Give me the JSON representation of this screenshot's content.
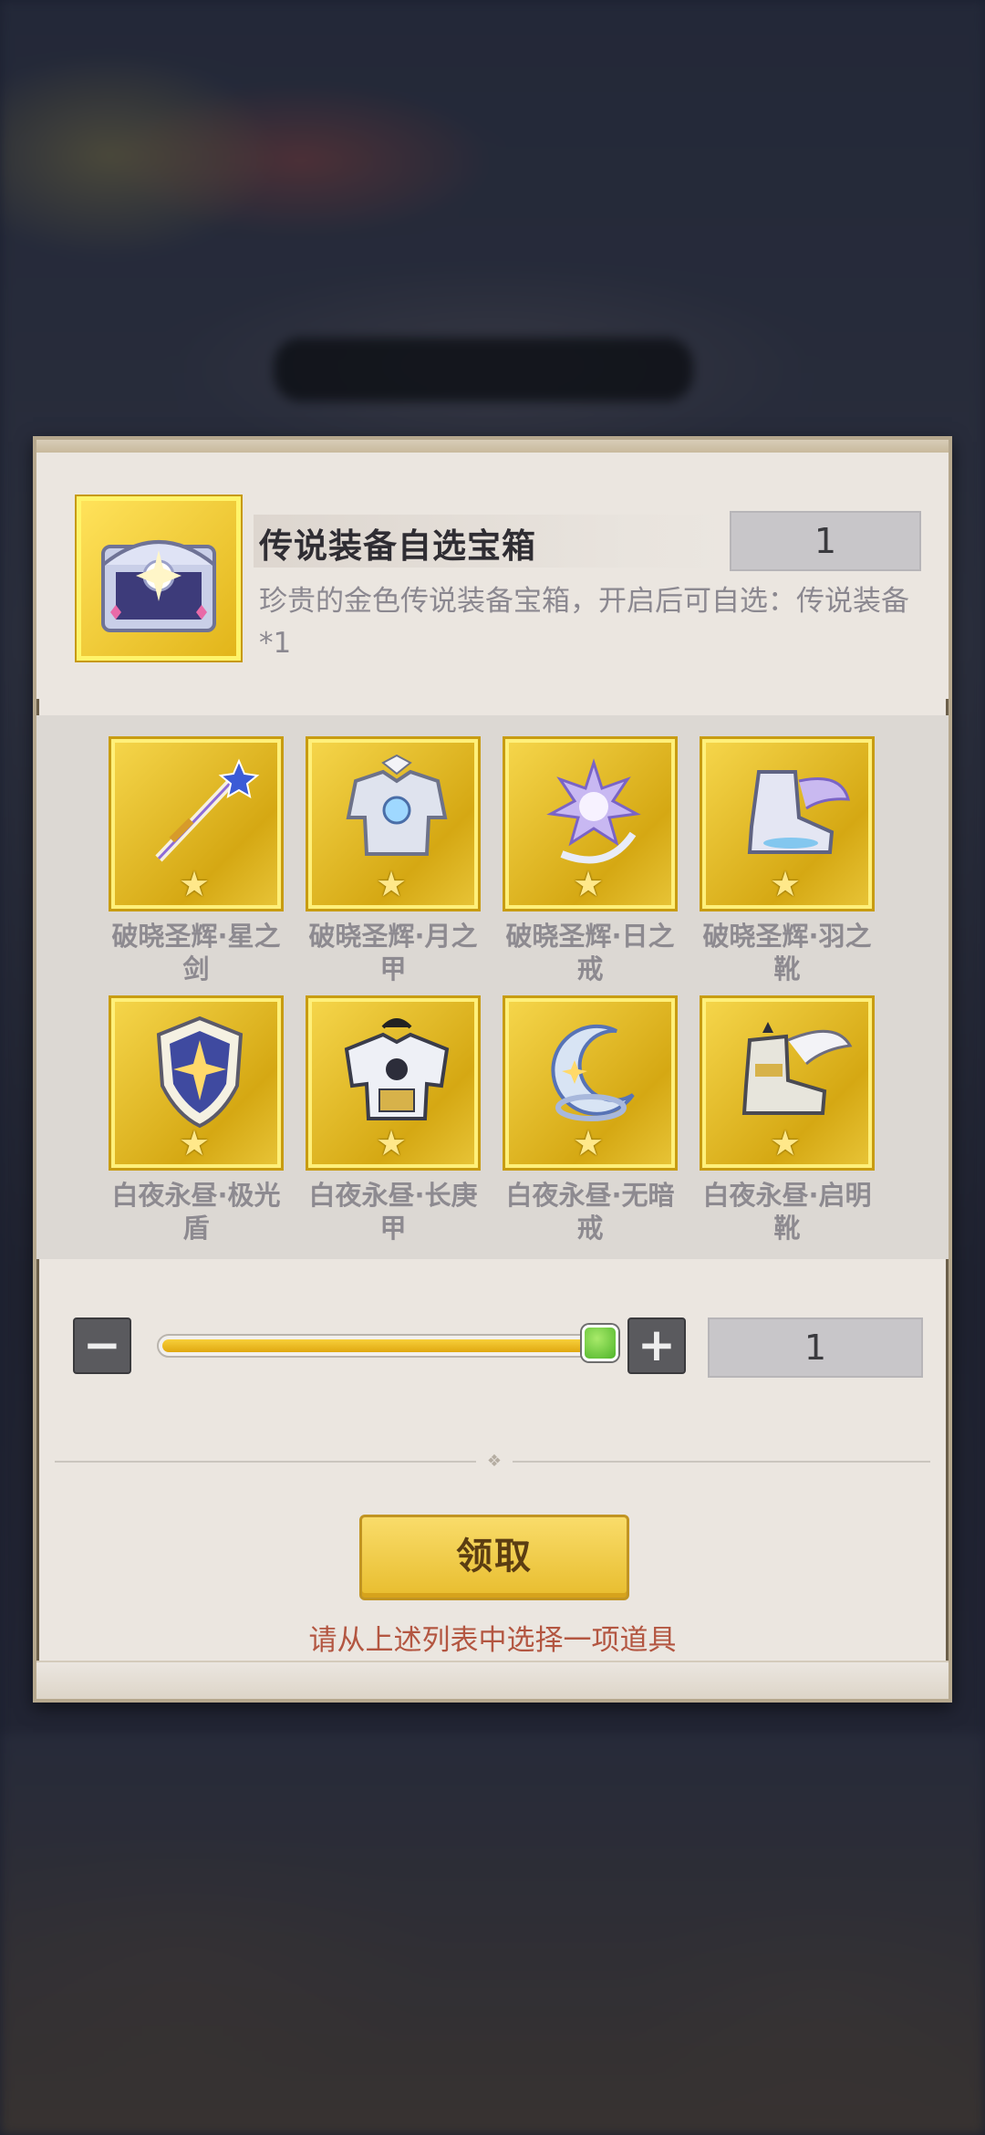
{
  "chest": {
    "title": "传说装备自选宝箱",
    "count": "1",
    "description": "珍贵的金色传说装备宝箱，开启后可自选：传说装备*1"
  },
  "items": [
    {
      "name": "破晓圣辉·星之剑",
      "icon": "star-sword-icon",
      "stars": 1
    },
    {
      "name": "破晓圣辉·月之甲",
      "icon": "moon-armor-icon",
      "stars": 1
    },
    {
      "name": "破晓圣辉·日之戒",
      "icon": "sun-ring-icon",
      "stars": 1
    },
    {
      "name": "破晓圣辉·羽之靴",
      "icon": "feather-boots-icon",
      "stars": 1
    },
    {
      "name": "白夜永昼·极光盾",
      "icon": "aurora-shield-icon",
      "stars": 1
    },
    {
      "name": "白夜永昼·长庚甲",
      "icon": "evening-star-armor-icon",
      "stars": 1
    },
    {
      "name": "白夜永昼·无暗戒",
      "icon": "crescent-ring-icon",
      "stars": 1
    },
    {
      "name": "白夜永昼·启明靴",
      "icon": "dawn-boots-icon",
      "stars": 1
    }
  ],
  "quantity": {
    "minus_label": "−",
    "plus_label": "+",
    "value": "1",
    "slider_fraction": 1.0
  },
  "claim_button": "领取",
  "hint": "请从上述列表中选择一项道具",
  "colors": {
    "accent_gold": "#e8bd2e",
    "hint_red": "#b35641",
    "slider_green": "#4fb52a"
  }
}
